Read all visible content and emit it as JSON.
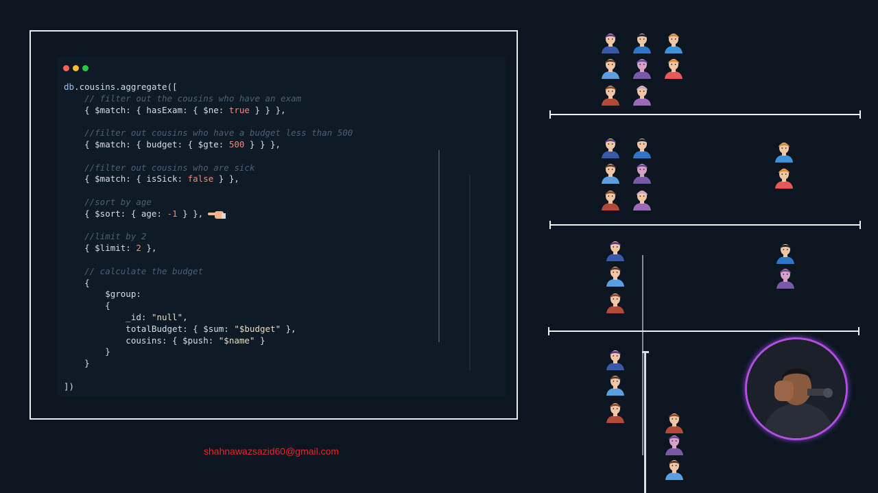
{
  "code": {
    "lines": [
      "db.cousins.aggregate([",
      "    // filter out the cousins who have an exam",
      "    { $match: { hasExam: { $ne: true } } },",
      "",
      "    //filter out cousins who have a budget less than 500",
      "    { $match: { budget: { $gte: 500 } } },",
      "",
      "    //filter out cousins who are sick",
      "    { $match: { isSick: false } },",
      "",
      "    //sort by age",
      "    { $sort: { age: -1 } },",
      "",
      "    //limit by 2",
      "    { $limit: 2 },",
      "",
      "    // calculate the budget",
      "    {",
      "        $group:",
      "        {",
      "            _id: \"null\",",
      "            totalBudget: { $sum: \"$budget\" },",
      "            cousins: { $push: \"$name\" }",
      "        }",
      "    }",
      "",
      "])"
    ]
  },
  "email": "shahnawazsazid60@gmail.com",
  "colors": {
    "background": "#0c1621",
    "editor_bg": "#0e1b27",
    "dot_red": "#ff5f57",
    "dot_yellow": "#febc2e",
    "dot_green": "#28c840",
    "webcam_ring": "#b34fe0",
    "email": "#e5262b"
  },
  "icons": {
    "pointer": "pointing-hand-icon",
    "person": "person-avatar-icon"
  }
}
